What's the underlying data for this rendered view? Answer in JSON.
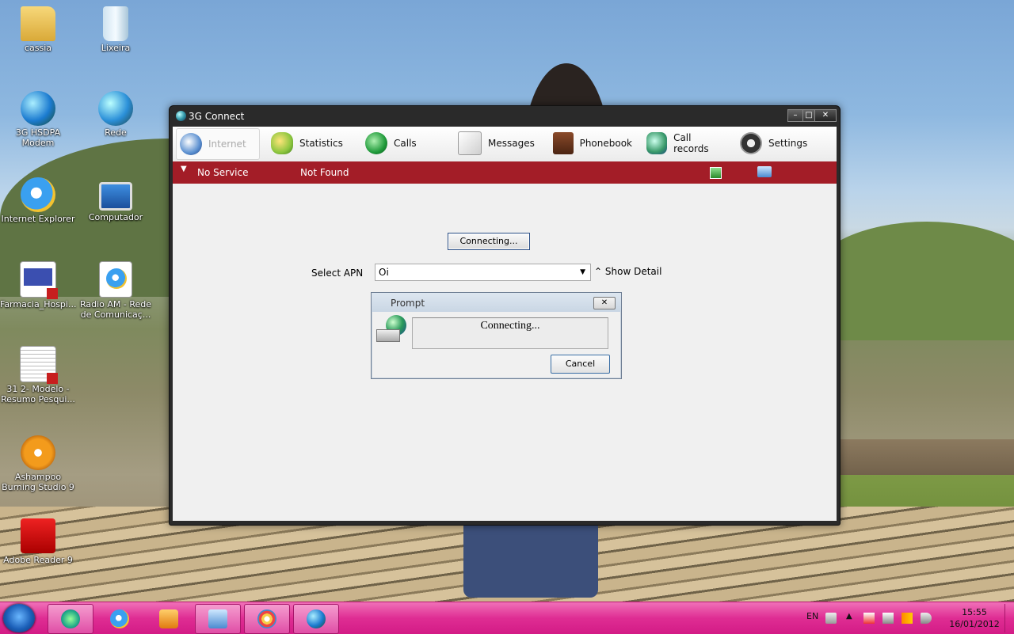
{
  "desktop": {
    "icons": [
      {
        "label": "cassia"
      },
      {
        "label": "Lixeira"
      },
      {
        "label": "3G HSDPA Modem"
      },
      {
        "label": "Rede"
      },
      {
        "label": "Internet Explorer"
      },
      {
        "label": "Computador"
      },
      {
        "label": "Farmacia_Hospi..."
      },
      {
        "label": "Radio AM - Rede de Comunicaç..."
      },
      {
        "label": "31 2- Modelo - Resumo Pesqui..."
      },
      {
        "label": "Ashampoo Burning Studio 9"
      },
      {
        "label": "Adobe Reader 9"
      }
    ]
  },
  "window": {
    "title": "3G Connect",
    "toolbar": [
      {
        "label": "Internet",
        "icon": "globe-icon"
      },
      {
        "label": "Statistics",
        "icon": "statistics-icon"
      },
      {
        "label": "Calls",
        "icon": "phone-icon"
      },
      {
        "label": "Messages",
        "icon": "envelope-icon"
      },
      {
        "label": "Phonebook",
        "icon": "phonebook-icon"
      },
      {
        "label": "Call records",
        "icon": "call-records-icon"
      },
      {
        "label": "Settings",
        "icon": "settings-icon"
      }
    ],
    "status": {
      "signal": "No Service",
      "network": "Not Found",
      "color": "#a31d27"
    },
    "main": {
      "connect_button": "Connecting...",
      "apn_label": "Select APN",
      "apn_value": "Oi",
      "show_detail": "Show Detail"
    }
  },
  "prompt": {
    "title": "Prompt",
    "message": "Connecting...",
    "cancel": "Cancel"
  },
  "taskbar": {
    "color": "#df2d93",
    "language": "EN",
    "time": "15:55",
    "date": "16/01/2012"
  }
}
